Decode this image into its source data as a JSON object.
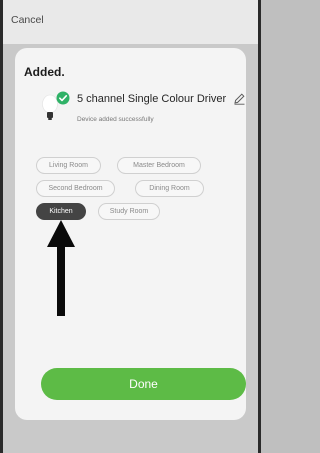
{
  "header": {
    "cancel_label": "Cancel"
  },
  "result": {
    "title": "Added."
  },
  "device": {
    "name": "5 channel Single Colour Driver",
    "status": "Device added successfully",
    "icon": "bulb-icon",
    "success_badge_icon": "check-badge-icon",
    "edit_icon": "pencil-icon"
  },
  "rooms": {
    "items": [
      {
        "label": "Living Room",
        "selected": false
      },
      {
        "label": "Master Bedroom",
        "selected": false
      },
      {
        "label": "Second Bedroom",
        "selected": false
      },
      {
        "label": "Dining Room",
        "selected": false
      },
      {
        "label": "Kitchen",
        "selected": true
      },
      {
        "label": "Study Room",
        "selected": false
      }
    ]
  },
  "done_button": {
    "label": "Done"
  },
  "colors": {
    "accent": "#5dbb46",
    "selected_chip": "#444444",
    "card_background": "#f4f4f4"
  }
}
